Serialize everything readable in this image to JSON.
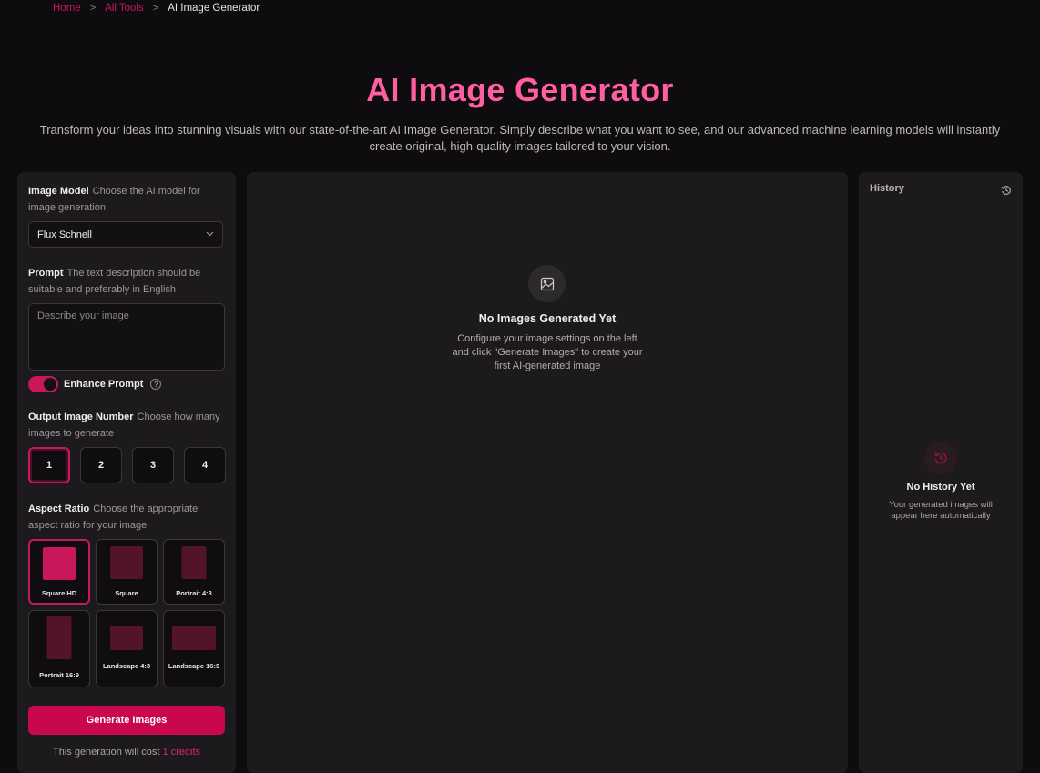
{
  "breadcrumb": {
    "home": "Home",
    "all_tools": "All Tools",
    "current": "AI Image Generator",
    "separator": ">"
  },
  "header": {
    "title": "AI Image Generator",
    "subtitle": "Transform your ideas into stunning visuals with our state-of-the-art AI Image Generator. Simply describe what you want to see, and our advanced machine learning models will instantly create original, high-quality images tailored to your vision."
  },
  "settings": {
    "model": {
      "label": "Image Model",
      "hint": "Choose the AI model for image generation",
      "value": "Flux Schnell"
    },
    "prompt": {
      "label": "Prompt",
      "hint": "The text description should be suitable and preferably in English",
      "placeholder": "Describe your image"
    },
    "enhance": {
      "label": "Enhance Prompt",
      "enabled": true
    },
    "output": {
      "label": "Output Image Number",
      "hint": "Choose how many images to generate",
      "options": [
        "1",
        "2",
        "3",
        "4"
      ],
      "selected": "1"
    },
    "aspect": {
      "label": "Aspect Ratio",
      "hint": "Choose the appropriate aspect ratio for your image",
      "options": [
        "Square HD",
        "Square",
        "Portrait 4:3",
        "Portrait 16:9",
        "Landscape 4:3",
        "Landscape 16:9"
      ],
      "selected": "Square HD"
    },
    "generate_label": "Generate Images",
    "cost_prefix": "This generation will cost",
    "cost_value": "1 credits"
  },
  "preview": {
    "empty_icon": "image-icon",
    "empty_title": "No Images Generated Yet",
    "empty_desc": "Configure your image settings on the left and click \"Generate Images\" to create your first AI-generated image"
  },
  "history": {
    "title": "History",
    "icon": "history-icon",
    "empty_title": "No History Yet",
    "empty_desc": "Your generated images will appear here automatically"
  },
  "colors": {
    "accent": "#c8175a",
    "title": "#ff5fa2",
    "background": "#0e0c0e",
    "panel": "#1d1a1d"
  }
}
